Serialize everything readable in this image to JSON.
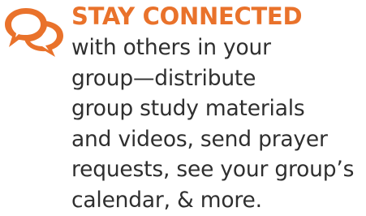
{
  "colors": {
    "accent": "#e9722b",
    "text": "#2f2f2f",
    "background": "#ffffff"
  },
  "feature": {
    "icon": "chat-bubbles-icon",
    "heading": "STAY CONNECTED",
    "body_lines": [
      "with others in your",
      "group—distribute",
      "group study materials",
      "and videos, send prayer",
      "requests, see your group’s",
      "calendar, & more."
    ]
  }
}
